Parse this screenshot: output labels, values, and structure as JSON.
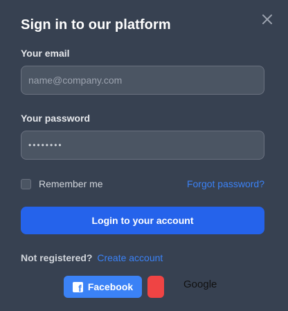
{
  "modal": {
    "title": "Sign in to our platform",
    "close_icon": "close-icon"
  },
  "form": {
    "email_label": "Your email",
    "email_placeholder": "name@company.com",
    "email_value": "",
    "password_label": "Your password",
    "password_value": "••••••••",
    "remember_label": "Remember me",
    "remember_checked": false,
    "forgot_label": "Forgot password?",
    "login_label": "Login to your account"
  },
  "register": {
    "prompt": "Not registered?",
    "link_label": "Create account"
  },
  "social": {
    "facebook_label": "Facebook",
    "facebook_icon": "facebook-icon",
    "google_label": "Google",
    "google_icon": "google-icon"
  },
  "colors": {
    "background": "#374151",
    "accent": "#2563eb",
    "link": "#3b82f6",
    "google": "#ef4444"
  }
}
